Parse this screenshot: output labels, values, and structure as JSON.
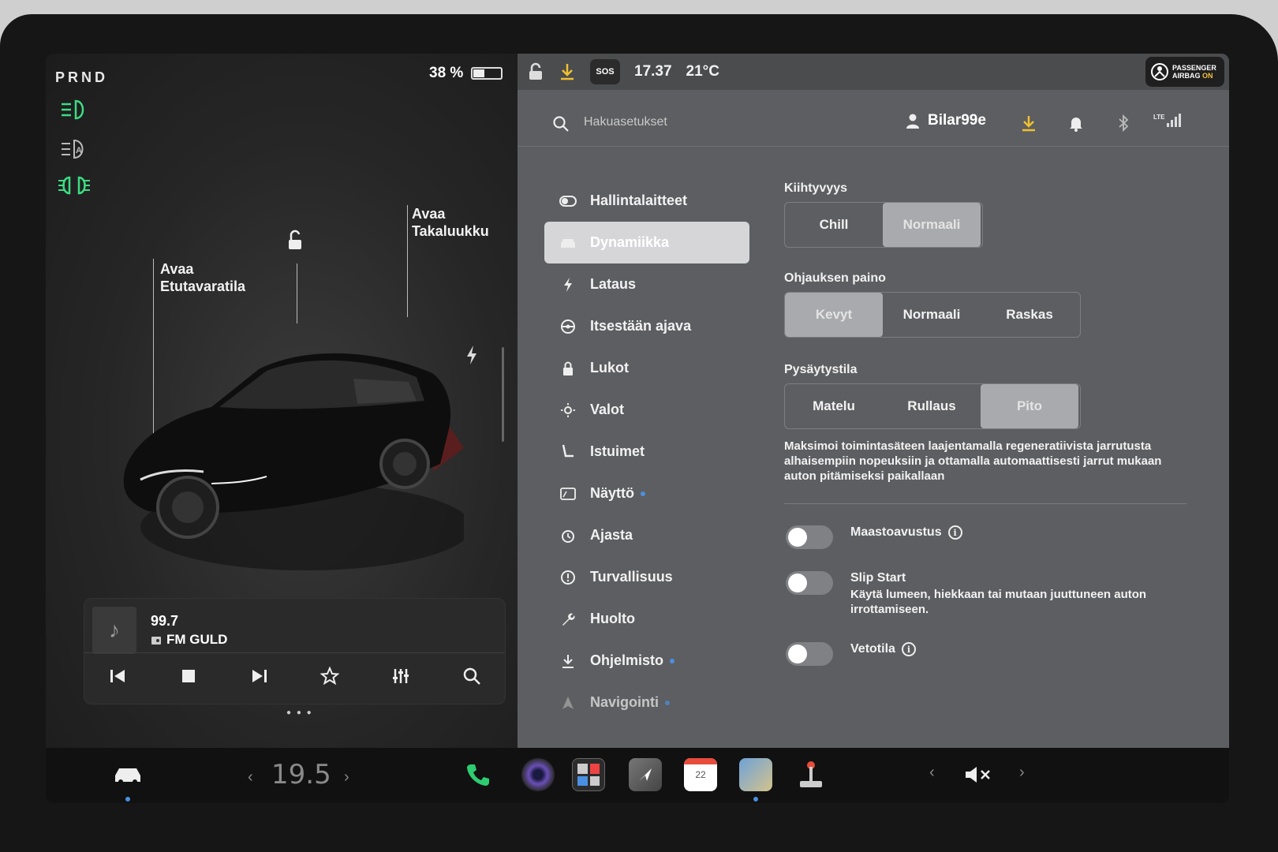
{
  "left": {
    "gear": "PRND",
    "battery_percent": "38 %",
    "battery_level": 0.38,
    "frunk_label_line1": "Avaa",
    "frunk_label_line2": "Etutavaratila",
    "trunk_label_line1": "Avaa",
    "trunk_label_line2": "Takaluukku"
  },
  "music": {
    "frequency": "99.7",
    "station": "FM GULD"
  },
  "status": {
    "sos": "SOS",
    "time": "17.37",
    "temperature": "21°C",
    "airbag_line1": "PASSENGER",
    "airbag_line2": "AIRBAG",
    "airbag_state": "ON"
  },
  "header": {
    "search_placeholder": "Hakuasetukset",
    "user": "Bilar99e",
    "signal_label": "LTE"
  },
  "nav": [
    {
      "label": "Hallintalaitteet",
      "icon": "toggle-icon"
    },
    {
      "label": "Dynamiikka",
      "icon": "car-icon"
    },
    {
      "label": "Lataus",
      "icon": "bolt-icon"
    },
    {
      "label": "Itsestään ajava",
      "icon": "steering-wheel-icon"
    },
    {
      "label": "Lukot",
      "icon": "lock-icon"
    },
    {
      "label": "Valot",
      "icon": "sun-icon"
    },
    {
      "label": "Istuimet",
      "icon": "seat-icon"
    },
    {
      "label": "Näyttö",
      "icon": "display-icon"
    },
    {
      "label": "Ajasta",
      "icon": "alarm-clock-icon"
    },
    {
      "label": "Turvallisuus",
      "icon": "alert-circle-icon"
    },
    {
      "label": "Huolto",
      "icon": "wrench-icon"
    },
    {
      "label": "Ohjelmisto",
      "icon": "download-icon"
    },
    {
      "label": "Navigointi",
      "icon": "navigation-icon"
    }
  ],
  "settings": {
    "acceleration": {
      "title": "Kiihtyvyys",
      "options": [
        "Chill",
        "Normaali"
      ],
      "selected": "Normaali"
    },
    "steering": {
      "title": "Ohjauksen paino",
      "options": [
        "Kevyt",
        "Normaali",
        "Raskas"
      ],
      "selected": "Kevyt"
    },
    "stopping": {
      "title": "Pysäytystila",
      "options": [
        "Matelu",
        "Rullaus",
        "Pito"
      ],
      "selected": "Pito"
    },
    "stopping_desc": "Maksimoi toimintasäteen laajentamalla regeneratiivista jarrutusta alhaisempiin nopeuksiin ja ottamalla automaattisesti jarrut mukaan auton pitämiseksi paikallaan",
    "toggles": [
      {
        "label": "Maastoavustus",
        "desc": "",
        "on": false
      },
      {
        "label": "Slip Start",
        "desc": "Käytä lumeen, hiekkaan tai mutaan juuttuneen auton irrottamiseen.",
        "on": false
      },
      {
        "label": "Vetotila",
        "desc": "",
        "on": false
      }
    ]
  },
  "dock": {
    "cabin_temp": "19.5",
    "calendar_day": "22"
  },
  "colors": {
    "headlight_green": "#3ddc84",
    "accent_blue": "#4a90e2",
    "download_yellow": "#f0c030",
    "phone_green": "#2ecc71"
  }
}
